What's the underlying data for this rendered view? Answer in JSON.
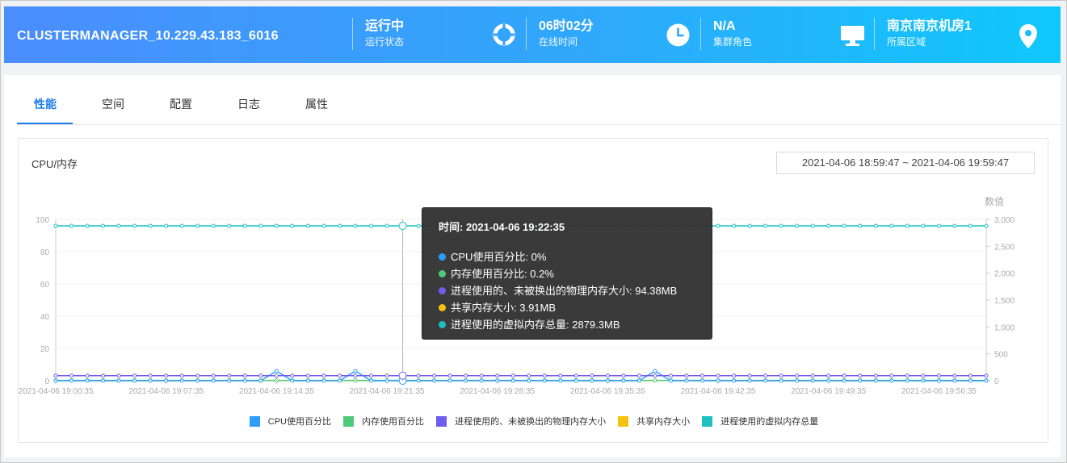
{
  "header": {
    "cluster_name": "CLUSTERMANAGER_10.229.43.183_6016",
    "stats": [
      {
        "value": "运行中",
        "label": "运行状态",
        "icon": "lifebuoy-icon"
      },
      {
        "value": "06时02分",
        "label": "在线时间",
        "icon": "clock-icon"
      },
      {
        "value": "N/A",
        "label": "集群角色",
        "icon": "monitor-icon"
      },
      {
        "value": "南京南京机房1",
        "label": "所属区域",
        "icon": "location-pin-icon"
      }
    ]
  },
  "tabs": [
    "性能",
    "空间",
    "配置",
    "日志",
    "属性"
  ],
  "active_tab": "性能",
  "chart_card": {
    "title": "CPU/内存",
    "date_range": "2021-04-06 18:59:47 ~ 2021-04-06 19:59:47"
  },
  "tooltip": {
    "time": "时间: 2021-04-06 19:22:35",
    "rows": [
      {
        "label": "CPU使用百分比: 0%",
        "color": "#2e9dfc"
      },
      {
        "label": "内存使用百分比: 0.2%",
        "color": "#4fc97a"
      },
      {
        "label": "进程使用的、未被换出的物理内存大小: 94.38MB",
        "color": "#6f5cf0"
      },
      {
        "label": "共享内存大小: 3.91MB",
        "color": "#f5c20f"
      },
      {
        "label": "进程使用的虚拟内存总量: 2879.3MB",
        "color": "#1cc0c0"
      }
    ]
  },
  "chart_data": {
    "type": "line",
    "title": "CPU/内存",
    "ylabel_right": "数值",
    "left_axis": {
      "ylim": [
        0,
        100
      ],
      "ticks": [
        0,
        20,
        40,
        60,
        80,
        100
      ]
    },
    "right_axis": {
      "ylim": [
        0,
        3000
      ],
      "ticks": [
        "0",
        "500",
        "1,000",
        "1,500",
        "2,000",
        "2,500",
        "3,000"
      ]
    },
    "x_tick_labels": [
      "2021-04-06 19:00:35",
      "2021-04-06 19:07:35",
      "2021-04-06 19:14:35",
      "2021-04-06 19:21:35",
      "2021-04-06 19:28:35",
      "2021-04-06 19:35:35",
      "2021-04-06 19:42:35",
      "2021-04-06 19:49:35",
      "2021-04-06 19:56:35"
    ],
    "x_start": "2021-04-06 19:00:35",
    "x_end": "2021-04-06 19:59:35",
    "sample_interval_minutes": 1,
    "grid": true,
    "legend_position": "bottom",
    "highlight_x": "2021-04-06 19:22:35",
    "series": [
      {
        "name": "CPU使用百分比",
        "axis": "left",
        "color": "#2e9dfc",
        "default": 0,
        "peaks": [
          {
            "x": "2021-04-06 19:14:35",
            "y": 6
          },
          {
            "x": "2021-04-06 19:19:35",
            "y": 6
          },
          {
            "x": "2021-04-06 19:38:35",
            "y": 6
          }
        ]
      },
      {
        "name": "内存使用百分比",
        "axis": "left",
        "color": "#4fc97a",
        "default": 0.2,
        "peaks": []
      },
      {
        "name": "进程使用的、未被换出的物理内存大小",
        "axis": "right",
        "color": "#6f5cf0",
        "default": 94.38,
        "peaks": []
      },
      {
        "name": "共享内存大小",
        "axis": "right",
        "color": "#f5c20f",
        "default": 3.91,
        "peaks": []
      },
      {
        "name": "进程使用的虚拟内存总量",
        "axis": "right",
        "color": "#1cc0c0",
        "default": 2879.3,
        "peaks": []
      }
    ]
  }
}
